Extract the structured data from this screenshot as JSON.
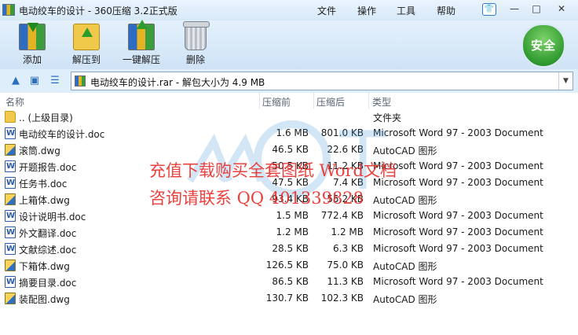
{
  "window": {
    "title": "电动绞车的设计 - 360压缩 3.2正式版",
    "menu": [
      "文件",
      "操作",
      "工具",
      "帮助"
    ],
    "controls": {
      "minimize": "—",
      "maximize": "□",
      "close": "✕"
    }
  },
  "toolbar": {
    "add_label": "添加",
    "extract_label": "解压到",
    "oneclick_label": "一键解压",
    "delete_label": "删除",
    "safe_label": "安全"
  },
  "navbar": {
    "address": "电动绞车的设计.rar - 解包大小为 4.9 MB"
  },
  "columns": [
    "名称",
    "压缩前",
    "压缩后",
    "类型"
  ],
  "files": [
    {
      "name": ".. (上级目录)",
      "before": "",
      "after": "",
      "type": "文件夹",
      "icon": "folder-icon"
    },
    {
      "name": "电动绞车的设计.doc",
      "before": "1.6 MB",
      "after": "801.0 KB",
      "type": "Microsoft Word 97 - 2003 Document",
      "icon": "word-doc-icon"
    },
    {
      "name": "滚筒.dwg",
      "before": "46.5 KB",
      "after": "22.6 KB",
      "type": "AutoCAD 图形",
      "icon": "autocad-dwg-icon"
    },
    {
      "name": "开题报告.doc",
      "before": "50.5 KB",
      "after": "11.2 KB",
      "type": "Microsoft Word 97 - 2003 Document",
      "icon": "word-doc-icon"
    },
    {
      "name": "任务书.doc",
      "before": "47.5 KB",
      "after": "7.4 KB",
      "type": "Microsoft Word 97 - 2003 Document",
      "icon": "word-doc-icon"
    },
    {
      "name": "上箱体.dwg",
      "before": "93.4 KB",
      "after": "55.2 KB",
      "type": "AutoCAD 图形",
      "icon": "autocad-dwg-icon"
    },
    {
      "name": "设计说明书.doc",
      "before": "1.5 MB",
      "after": "772.4 KB",
      "type": "Microsoft Word 97 - 2003 Document",
      "icon": "word-doc-icon"
    },
    {
      "name": "外文翻译.doc",
      "before": "1.2 MB",
      "after": "1.2 MB",
      "type": "Microsoft Word 97 - 2003 Document",
      "icon": "word-doc-icon"
    },
    {
      "name": "文献综述.doc",
      "before": "28.5 KB",
      "after": "6.3 KB",
      "type": "Microsoft Word 97 - 2003 Document",
      "icon": "word-doc-icon"
    },
    {
      "name": "下箱体.dwg",
      "before": "126.5 KB",
      "after": "75.0 KB",
      "type": "AutoCAD 图形",
      "icon": "autocad-dwg-icon"
    },
    {
      "name": "摘要目录.doc",
      "before": "86.5 KB",
      "after": "11.3 KB",
      "type": "Microsoft Word 97 - 2003 Document",
      "icon": "word-doc-icon"
    },
    {
      "name": "装配图.dwg",
      "before": "130.7 KB",
      "after": "102.3 KB",
      "type": "AutoCAD 图形",
      "icon": "autocad-dwg-icon"
    }
  ],
  "watermark": {
    "line1": "充值下载购买全套图纸 Word文档",
    "line2": "咨询请联系  QQ 401339828"
  },
  "colors": {
    "watermark": "#e8322e",
    "safe_badge": "#2f9a2f",
    "toolbar_bg": "#dcebf9"
  }
}
